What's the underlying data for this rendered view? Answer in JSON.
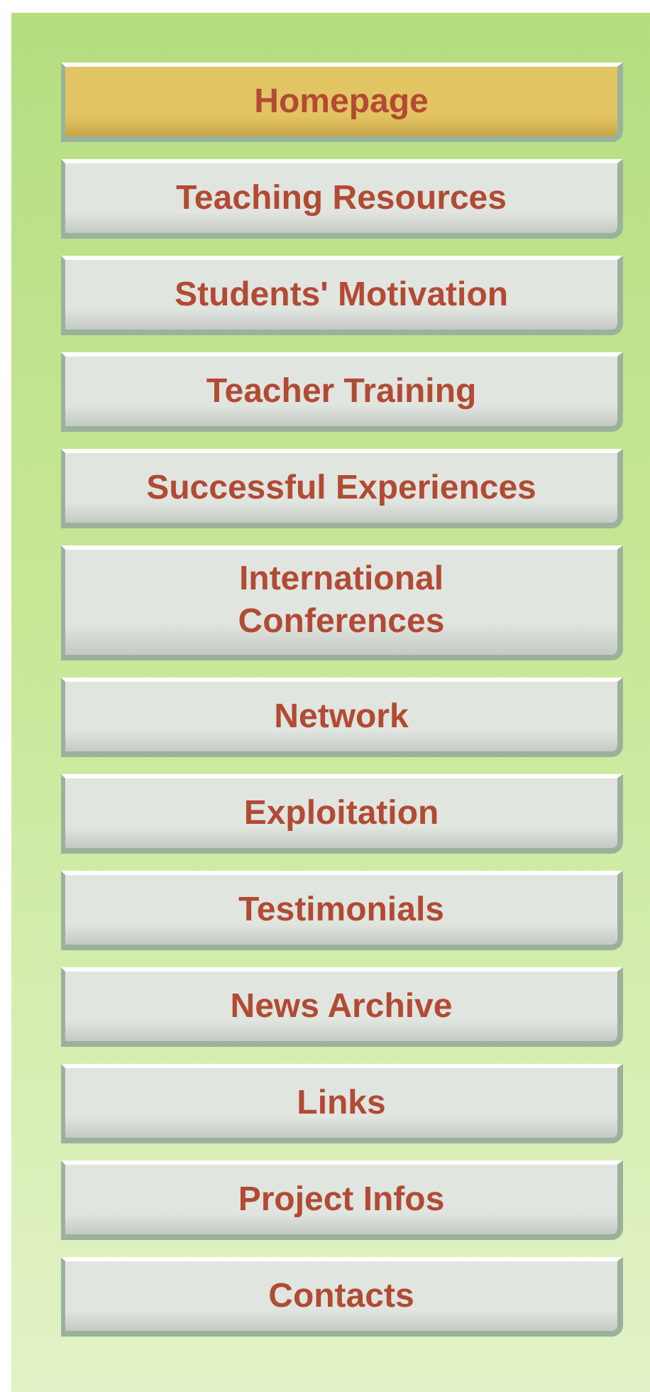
{
  "menu": [
    {
      "label": "Homepage",
      "selected": true
    },
    {
      "label": "Teaching Resources",
      "selected": false
    },
    {
      "label": "Students' Motivation",
      "selected": false
    },
    {
      "label": "Teacher Training",
      "selected": false
    },
    {
      "label": "Successful Experiences",
      "selected": false
    },
    {
      "label": "International Conferences",
      "selected": false
    },
    {
      "label": "Network",
      "selected": false
    },
    {
      "label": "Exploitation",
      "selected": false
    },
    {
      "label": "Testimonials",
      "selected": false
    },
    {
      "label": "News Archive",
      "selected": false
    },
    {
      "label": "Links",
      "selected": false
    },
    {
      "label": "Project Infos",
      "selected": false
    },
    {
      "label": "Contacts",
      "selected": false
    }
  ]
}
